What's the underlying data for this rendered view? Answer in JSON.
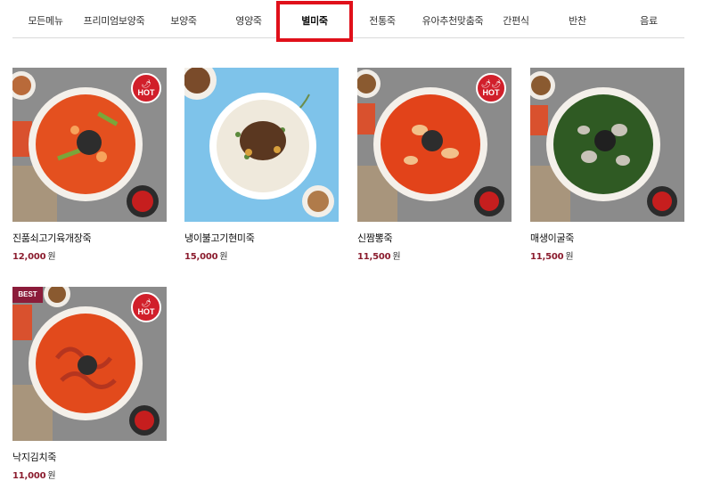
{
  "nav": {
    "tabs": [
      {
        "label": "모든메뉴",
        "active": false
      },
      {
        "label": "프리미엄보양죽",
        "active": false
      },
      {
        "label": "보양죽",
        "active": false
      },
      {
        "label": "영양죽",
        "active": false
      },
      {
        "label": "별미죽",
        "active": true
      },
      {
        "label": "전통죽",
        "active": false
      },
      {
        "label": "유아추천맞춤죽",
        "active": false
      },
      {
        "label": "간편식",
        "active": false
      },
      {
        "label": "반찬",
        "active": false
      },
      {
        "label": "음료",
        "active": false
      }
    ],
    "highlight_color": "#e0101a"
  },
  "products": [
    {
      "name": "진품쇠고기육개장죽",
      "price": "12,000",
      "unit": "원",
      "badge_hot": "HOT",
      "badge_best": null,
      "broth": "#e4501f",
      "bg": "#8c8c8c"
    },
    {
      "name": "냉이불고기현미죽",
      "price": "15,000",
      "unit": "원",
      "badge_hot": null,
      "badge_best": null,
      "broth": "#efe9dc",
      "bg": "#7ec3ea"
    },
    {
      "name": "신짬뽕죽",
      "price": "11,500",
      "unit": "원",
      "badge_hot": "HOT",
      "badge_best": null,
      "broth": "#e2431a",
      "bg": "#8a8a8a"
    },
    {
      "name": "매생이굴죽",
      "price": "11,500",
      "unit": "원",
      "badge_hot": null,
      "badge_best": null,
      "broth": "#2f5a23",
      "bg": "#8a8a8a"
    },
    {
      "name": "낙지김치죽",
      "price": "11,000",
      "unit": "원",
      "badge_hot": "HOT",
      "badge_best": "BEST",
      "broth": "#e24a1c",
      "bg": "#8a8a8a"
    }
  ],
  "colors": {
    "price": "#8b1c2e",
    "hot_badge": "#d11f2a",
    "best_badge": "#8b1c3a"
  }
}
